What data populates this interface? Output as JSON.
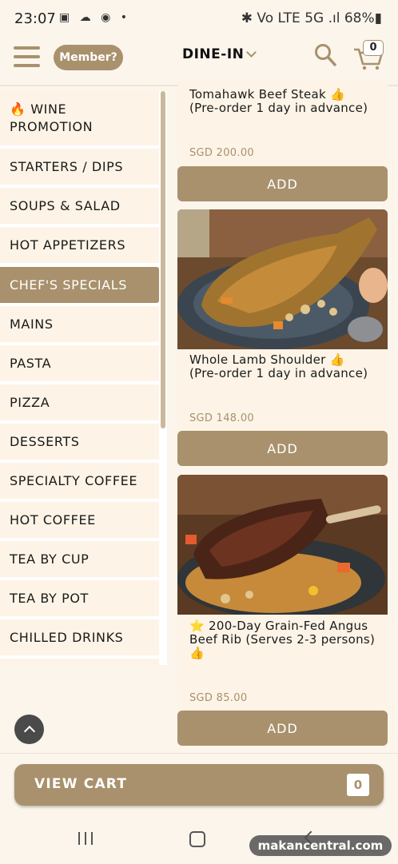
{
  "status_bar": {
    "time": "23:07",
    "icons_left": "▣ ☁ ◉ •",
    "icons_right": "✱ Vo LTE 5G .ıl 68%▮"
  },
  "header": {
    "member_label": "Member?",
    "mode_label": "DINE-IN",
    "cart_count": "0"
  },
  "categories": [
    {
      "label": "🔥 WINE PROMOTION",
      "active": false
    },
    {
      "label": "STARTERS / DIPS",
      "active": false
    },
    {
      "label": "SOUPS & SALAD",
      "active": false
    },
    {
      "label": "HOT APPETIZERS",
      "active": false
    },
    {
      "label": "CHEF'S SPECIALS",
      "active": true
    },
    {
      "label": "MAINS",
      "active": false
    },
    {
      "label": "PASTA",
      "active": false
    },
    {
      "label": "PIZZA",
      "active": false
    },
    {
      "label": "DESSERTS",
      "active": false
    },
    {
      "label": "SPECIALTY COFFEE",
      "active": false
    },
    {
      "label": "HOT COFFEE",
      "active": false
    },
    {
      "label": "TEA BY CUP",
      "active": false
    },
    {
      "label": "TEA BY POT",
      "active": false
    },
    {
      "label": "CHILLED DRINKS",
      "active": false
    }
  ],
  "products": [
    {
      "title_line1": "Tomahawk Beef Steak 👍",
      "title_line2": "(Pre-order 1 day in advance)",
      "title_line3": "",
      "price": "SGD 200.00",
      "add_label": "ADD"
    },
    {
      "title_line1": "Whole Lamb Shoulder 👍",
      "title_line2": "(Pre-order 1 day in advance)",
      "title_line3": "",
      "price": "SGD 148.00",
      "add_label": "ADD"
    },
    {
      "title_line1": "⭐ 200-Day Grain-Fed Angus",
      "title_line2": "Beef Rib (Serves 2-3 persons)",
      "title_line3": "👍",
      "price": "SGD 85.00",
      "add_label": "ADD"
    }
  ],
  "footer": {
    "view_cart_label": "VIEW CART",
    "cart_count": "0"
  },
  "watermark": "makancentral.com",
  "colors": {
    "accent": "#a8916c",
    "background": "#fbf5ec",
    "card": "#fdf4e7"
  }
}
